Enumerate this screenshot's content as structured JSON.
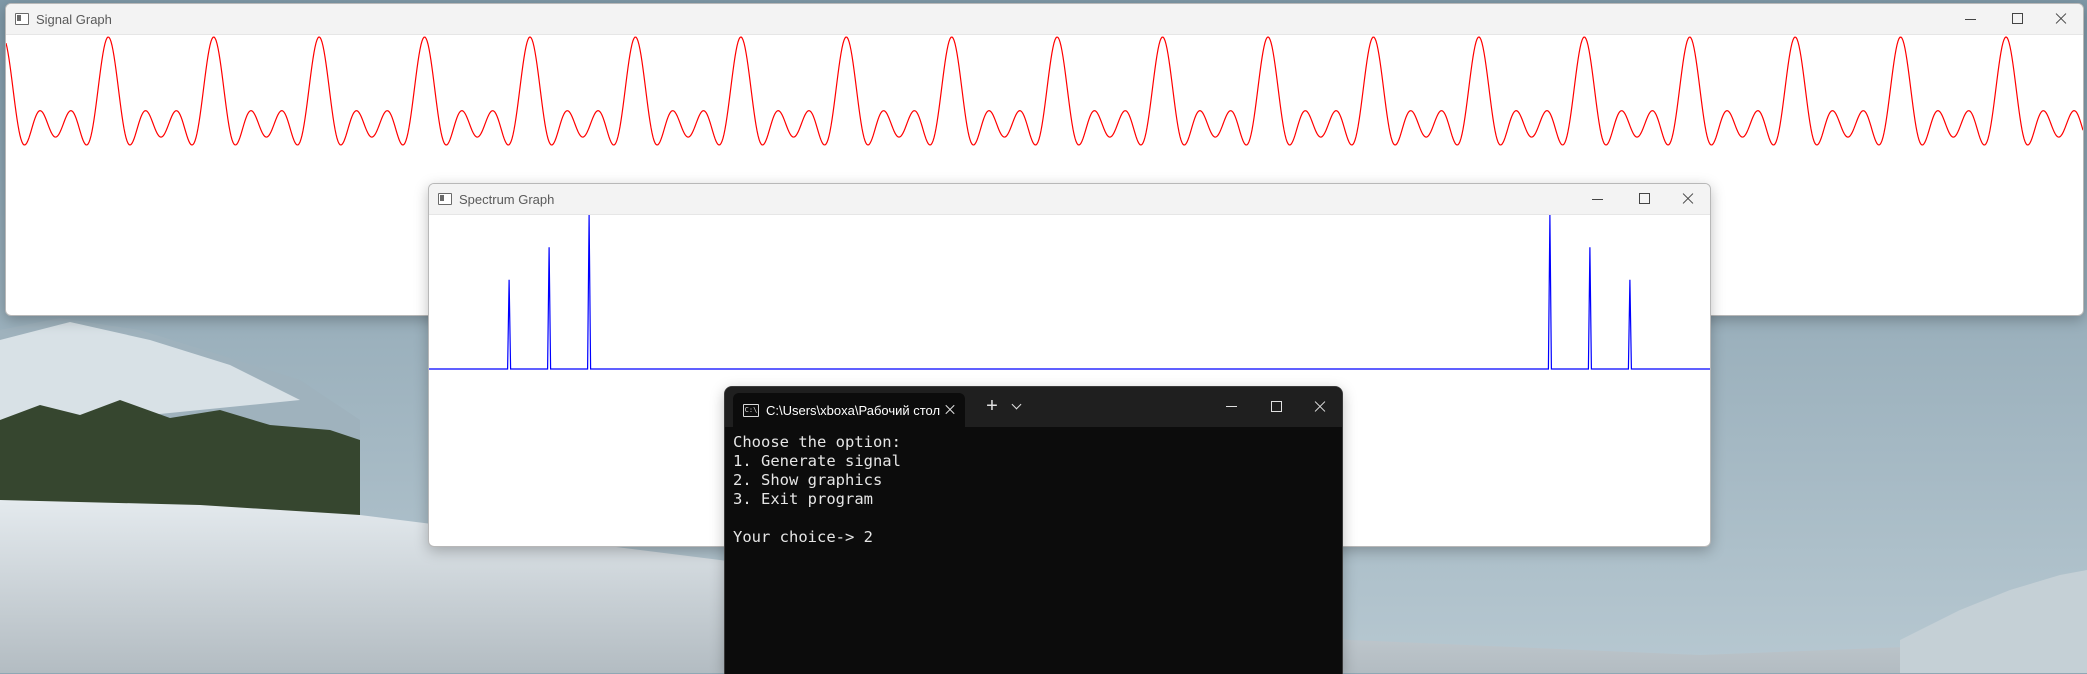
{
  "desktop": {
    "wallpaper": "snowy mountains landscape"
  },
  "signal_window": {
    "title": "Signal Graph",
    "icon": "app-window-icon",
    "line_color": "#ff0000"
  },
  "spectrum_window": {
    "title": "Spectrum Graph",
    "icon": "app-window-icon",
    "line_color": "#0000ff"
  },
  "terminal": {
    "tab_title": "C:\\Users\\xboxa\\Рабочий стол",
    "new_tab_label": "+",
    "lines": [
      "Choose the option:",
      "1. Generate signal",
      "2. Show graphics",
      "3. Exit program",
      "",
      "Your choice-> 2"
    ],
    "colors": {
      "background": "#0c0c0c",
      "text": "#e6e6e6",
      "tabbar": "#1f1f1f"
    }
  },
  "chart_data": [
    {
      "type": "line",
      "name": "signal",
      "periods_visible": 19.7,
      "components": [
        {
          "harmonic": 1,
          "amplitude": 0.33
        },
        {
          "harmonic": 2,
          "amplitude": 0.33
        },
        {
          "harmonic": 3,
          "amplitude": 0.33
        }
      ]
    },
    {
      "type": "line",
      "name": "spectrum",
      "bins": 512,
      "peaks": [
        {
          "bin": 32,
          "value": 0.58
        },
        {
          "bin": 48,
          "value": 0.79
        },
        {
          "bin": 64,
          "value": 1.0
        },
        {
          "bin": 448,
          "value": 1.0
        },
        {
          "bin": 464,
          "value": 0.79
        },
        {
          "bin": 480,
          "value": 0.58
        }
      ]
    }
  ]
}
